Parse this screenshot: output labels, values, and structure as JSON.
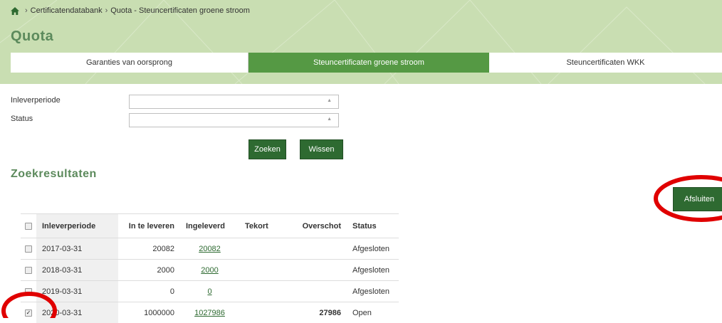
{
  "breadcrumb": {
    "items": [
      "Certificatendatabank",
      "Quota - Steuncertificaten groene stroom"
    ]
  },
  "page": {
    "title": "Quota",
    "results_title": "Zoekresultaten"
  },
  "tabs": [
    {
      "label": "Garanties van oorsprong",
      "active": false
    },
    {
      "label": "Steuncertificaten groene stroom",
      "active": true
    },
    {
      "label": "Steuncertificaten WKK",
      "active": false
    }
  ],
  "filters": {
    "period_label": "Inleverperiode",
    "period_value": "",
    "status_label": "Status",
    "status_value": ""
  },
  "buttons": {
    "search": "Zoeken",
    "clear": "Wissen",
    "close": "Afsluiten"
  },
  "table": {
    "headers": [
      "Inleverperiode",
      "In te leveren",
      "Ingeleverd",
      "Tekort",
      "Overschot",
      "Status"
    ],
    "rows": [
      {
        "checked": false,
        "period": "2017-03-31",
        "to_deliver": "20082",
        "delivered": "20082",
        "shortage": "",
        "surplus": "",
        "status": "Afgesloten"
      },
      {
        "checked": false,
        "period": "2018-03-31",
        "to_deliver": "2000",
        "delivered": "2000",
        "shortage": "",
        "surplus": "",
        "status": "Afgesloten"
      },
      {
        "checked": false,
        "period": "2019-03-31",
        "to_deliver": "0",
        "delivered": "0",
        "shortage": "",
        "surplus": "",
        "status": "Afgesloten"
      },
      {
        "checked": true,
        "period": "2020-03-31",
        "to_deliver": "1000000",
        "delivered": "1027986",
        "shortage": "",
        "surplus": "27986",
        "status": "Open"
      }
    ]
  },
  "colors": {
    "header_bg": "#c9deb2",
    "active_tab": "#559944",
    "button": "#2e6a31",
    "title": "#5c8a5c",
    "highlight": "#e00000"
  },
  "icons": {
    "home": "home-icon",
    "dropdown": "caret-up-icon",
    "checkbox": "checkbox-icon"
  }
}
